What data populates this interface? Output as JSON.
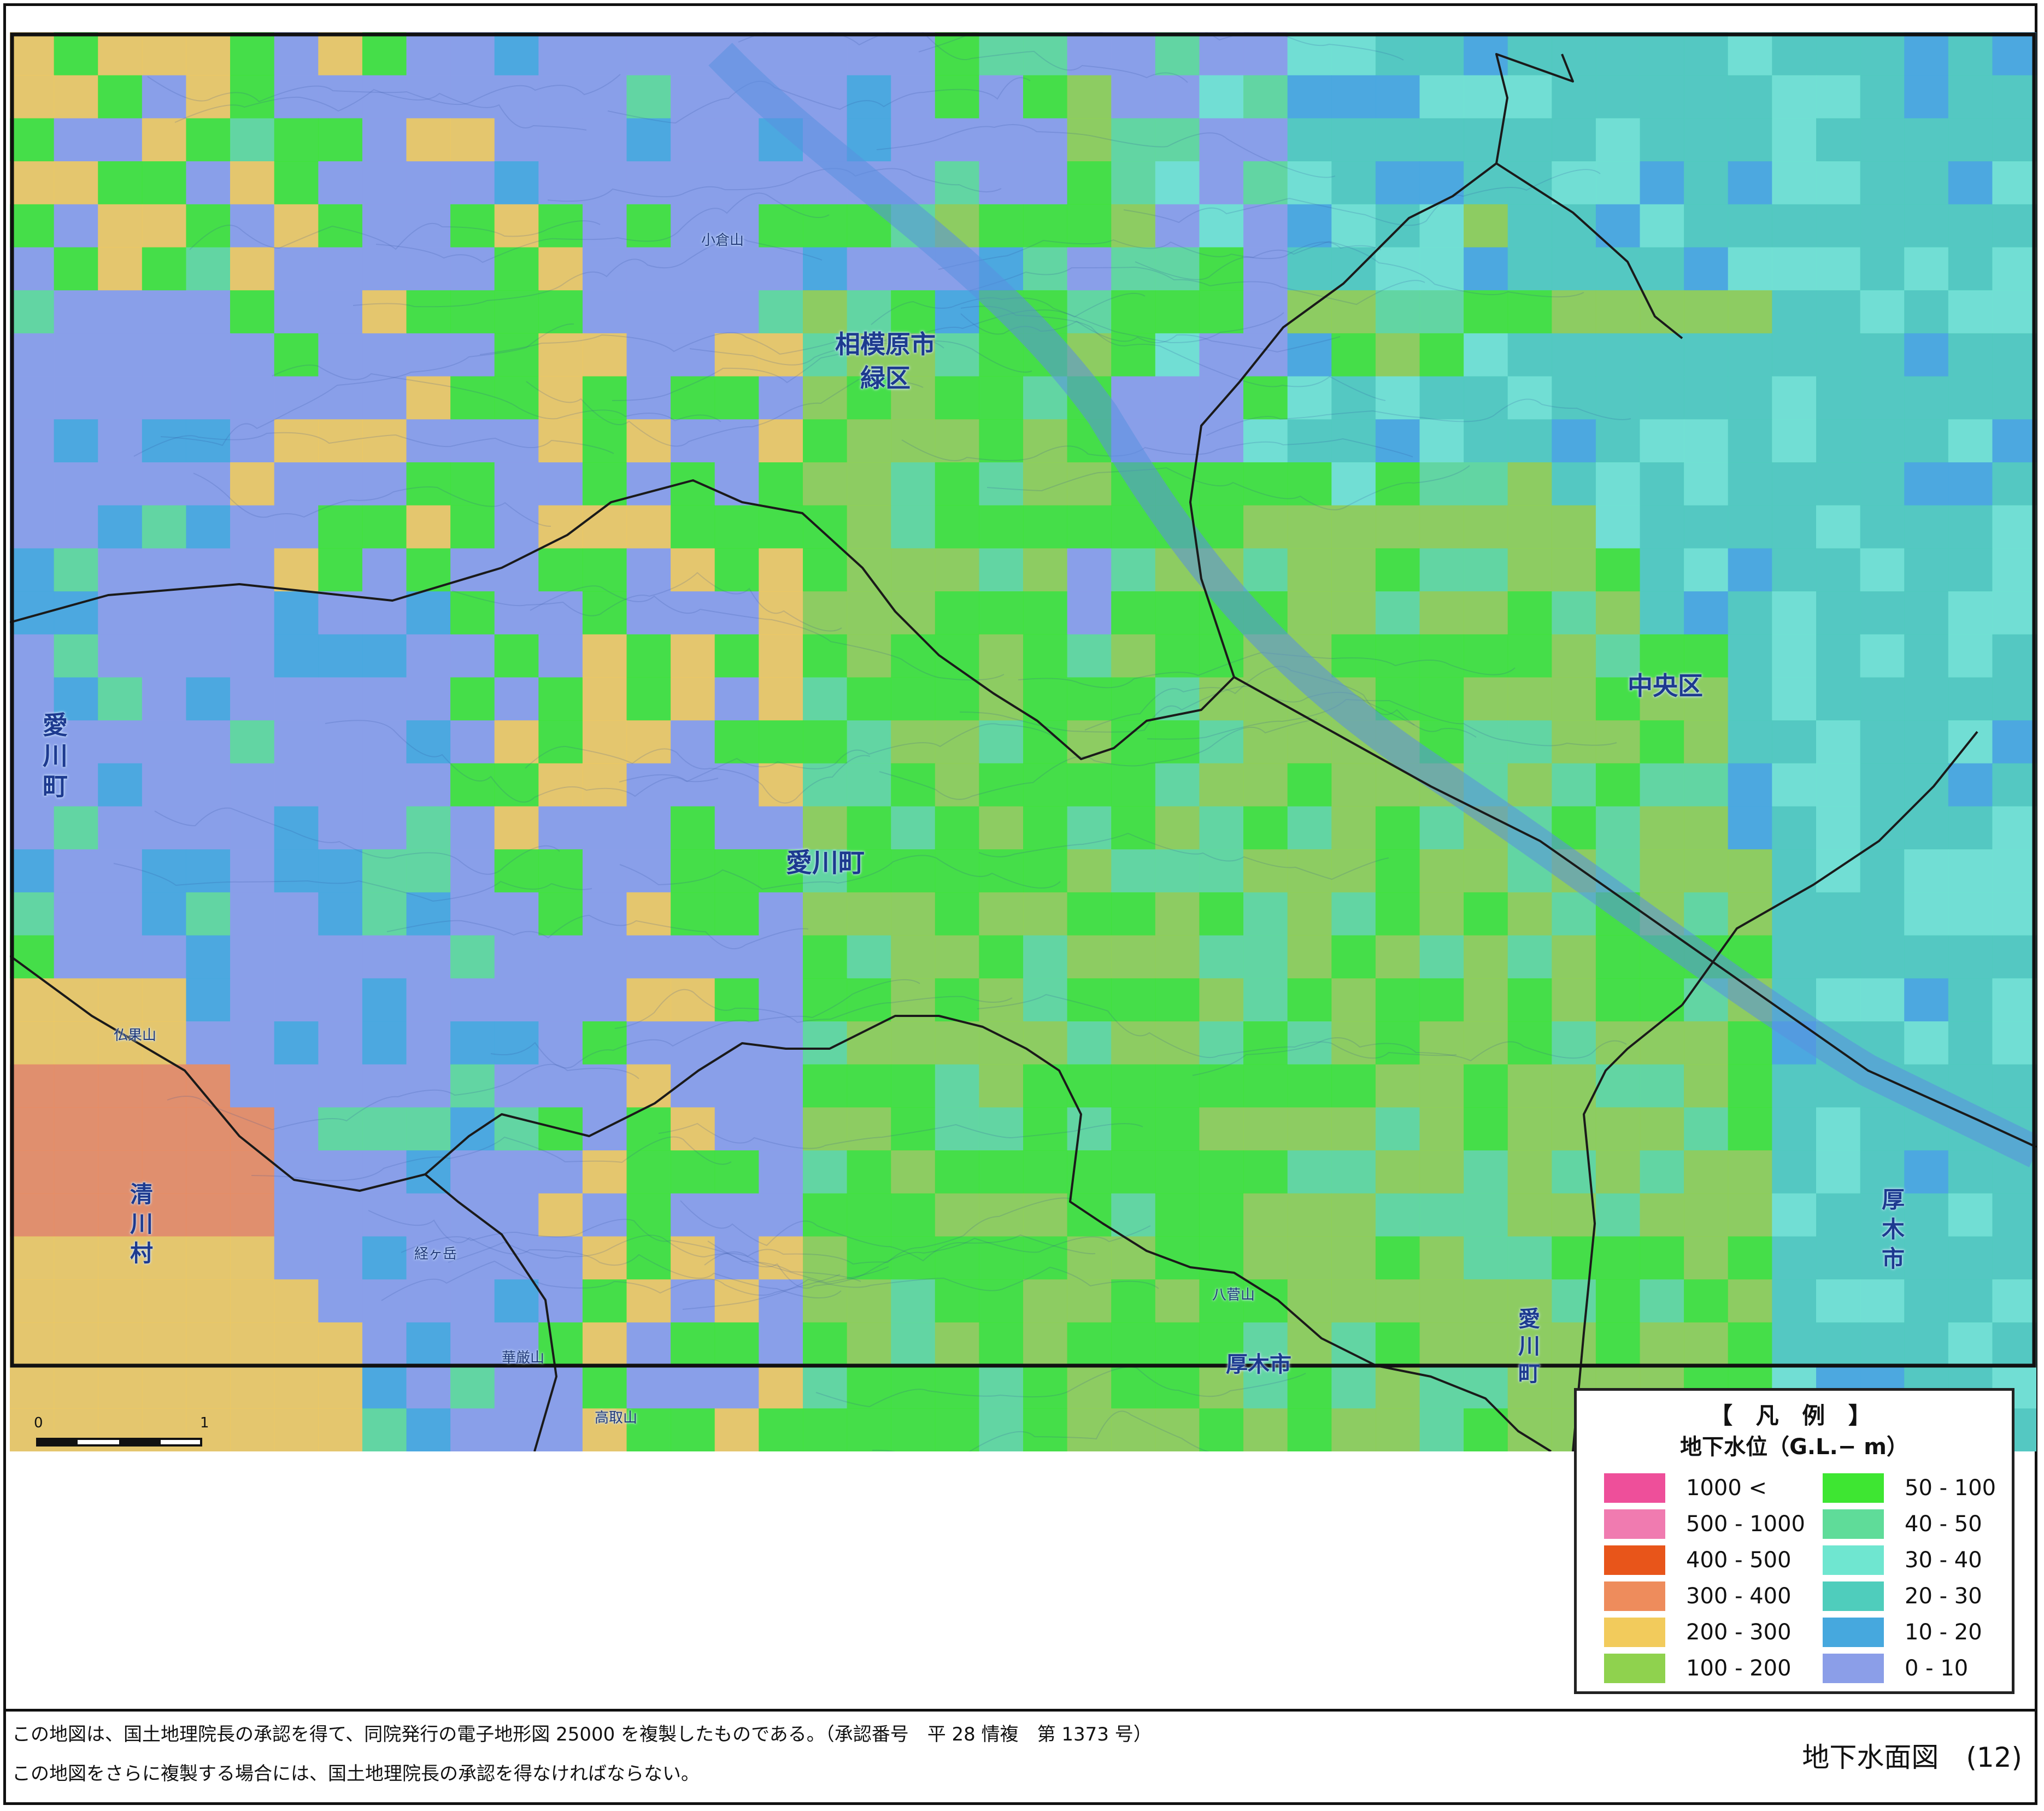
{
  "map": {
    "place_labels": [
      {
        "id": "sagamihara-midori",
        "lines": [
          "相模原市",
          "緑区"
        ]
      },
      {
        "id": "aikawa-center",
        "lines": [
          "愛川町"
        ]
      },
      {
        "id": "chuo-ku",
        "lines": [
          "中央区"
        ]
      },
      {
        "id": "aikawa-west",
        "lines": [
          "愛",
          "川",
          "町"
        ]
      },
      {
        "id": "kiyokawa",
        "lines": [
          "清",
          "川",
          "村"
        ]
      },
      {
        "id": "atsugi-east",
        "lines": [
          "厚",
          "木",
          "市"
        ]
      },
      {
        "id": "aikawa-south",
        "lines": [
          "愛",
          "川",
          "町"
        ]
      },
      {
        "id": "atsugi-south",
        "lines": [
          "厚木市"
        ]
      }
    ],
    "feature_labels": [
      "小倉山",
      "仏果山",
      "経ヶ岳",
      "華厳山",
      "高取山",
      "八菅山"
    ],
    "grid_class_indices": [
      "6666655554444444444445544444444444444444444444",
      "6655555544444444444445455444444444444444444444",
      "6555566555555544444444445444444444444444444444",
      "6555555444445444444444445444444444444444444444",
      "5555555555555555555555555544444445444444444444",
      "5666665555555444444444444555444444444444444444",
      "4444455555555555445554554555455555555555444444",
      "4444445555555555555555555544445554444444444444",
      "4444445555555555555555555444544444444444444444",
      "4444455555555555555555555444444444444444444444",
      "4444455555555555555555555555554555544444444444",
      "4444445555555555555555555555555555554444444444",
      "4444445555555555555555554555555555555444444444",
      "4444444444555555555555554555555555555444444444",
      "4444444444555555555555554555555555555554444444",
      "4444444444555555555555555555555555555554444444",
      "4444444444555555555555555555555555555554444444",
      "4444444444555555555555555555555555555554444444",
      "4444444444555555555555555555555555555554444444",
      "4444444444555555555555555555555555555555444444",
      "4444444444455555555555555555555555555555444444",
      "5554444444445555555555555555555555555555444444",
      "7777444444445555555555555555555555555555444444",
      "7777444444445555555555555555555555555555444444",
      "8888844444445555555555555555555555555555444444",
      "8888884444445555555555555555555555555555444444",
      "8888884444445555555555555555555555555555444444",
      "8888884444445555555555555555555555555555444444",
      "7777774444445555555555555555555555555555444444",
      "7777777444445555555555555555555555555555444444",
      "7777777744445555555555555555555555555555444444",
      "7777777744445555555555555555555555555555444444",
      "7777777744444555555555555555555555555555444444"
    ]
  },
  "scale_bar": {
    "start": "0",
    "end": "1",
    "unit": "km"
  },
  "legend": {
    "title": "【 凡 例 】",
    "subtitle": "地下水位（G.L.− m）",
    "classes": [
      {
        "label": "1000 <",
        "color": "#ee4f9a"
      },
      {
        "label": "500 - 1000",
        "color": "#f07bb0"
      },
      {
        "label": "400 - 500",
        "color": "#e8551a"
      },
      {
        "label": "300 - 400",
        "color": "#ee8c5c"
      },
      {
        "label": "200 - 300",
        "color": "#f2cb5c"
      },
      {
        "label": "100 - 200",
        "color": "#8fd24e"
      },
      {
        "label": "50 - 100",
        "color": "#3ee632"
      },
      {
        "label": "40 - 50",
        "color": "#5fdc99"
      },
      {
        "label": "30 - 40",
        "color": "#6fe6d0"
      },
      {
        "label": "20 - 30",
        "color": "#4fcdbc"
      },
      {
        "label": "10 - 20",
        "color": "#46a8de"
      },
      {
        "label": "0 - 10",
        "color": "#8b9ee8"
      }
    ]
  },
  "footer": {
    "note_line1": "この地図は、国土地理院長の承認を得て、同院発行の電子地形図 25000 を複製したものである。（承認番号　平 28 情複　第 1373 号）",
    "note_line2": "この地図をさらに複製する場合には、国土地理院長の承認を得なければならない。",
    "sheet_title": "地下水面図　(12)"
  }
}
